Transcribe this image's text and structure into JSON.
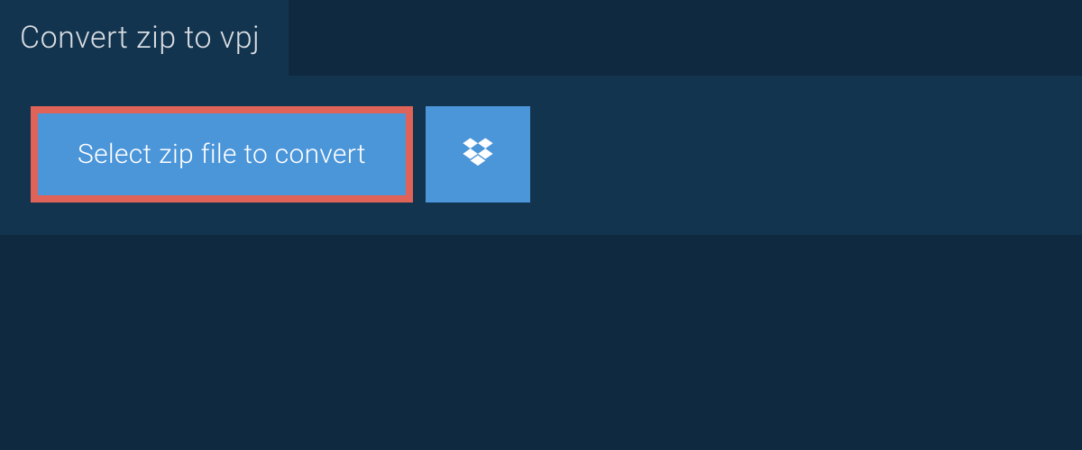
{
  "header": {
    "title": "Convert zip to vpj"
  },
  "actions": {
    "select_label": "Select zip file to convert"
  },
  "colors": {
    "bg": "#0f2940",
    "panel": "#13344f",
    "button": "#4b95d9",
    "highlight": "#e06359",
    "text_light": "#d8dde2"
  }
}
